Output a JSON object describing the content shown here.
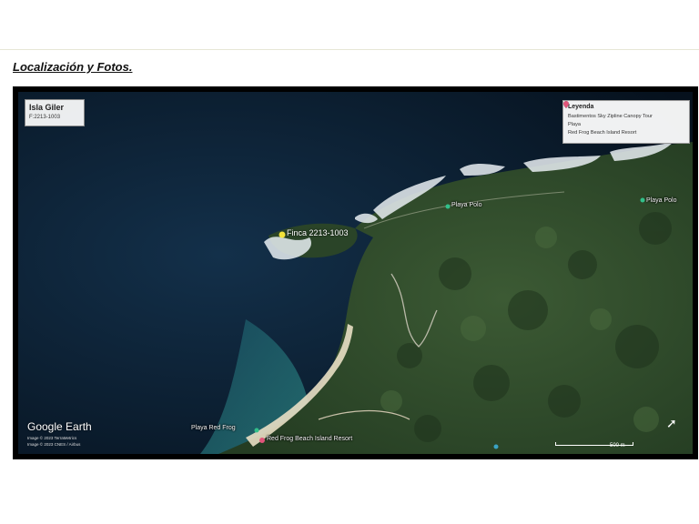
{
  "document": {
    "section_heading": "Localización y Fotos."
  },
  "map": {
    "title": "Isla Giler",
    "parcel_id": "F:2213-1003",
    "finca_label": "Finca 2213-1003",
    "legend": {
      "title": "Leyenda",
      "items": [
        {
          "label": "Bastimentos Sky Zipline Canopy Tour",
          "color": "#3aa3c4"
        },
        {
          "label": "Playa",
          "color": "#32c08a"
        },
        {
          "label": "Red Frog Beach Island Resort",
          "color": "#e0557a"
        }
      ]
    },
    "place_labels": {
      "playa_polo_1": "Playa Polo",
      "playa_polo_2": "Playa Polo",
      "playa_red_frog": "Playa Red Frog",
      "resort": "Red Frog Beach Island Resort"
    },
    "provider_logo": "Google Earth",
    "attribution": [
      "Image © 2023 TerraMetrics",
      "Image © 2023 CNES / Airbus"
    ],
    "scale_label": "500 m",
    "colors": {
      "ocean_deep": "#0a1a2c",
      "ocean_shallow": "#1d6a7a",
      "forest": "#2e4a2a",
      "pin_playa": "#32c08a",
      "pin_resort": "#e0557a",
      "finca_marker": "#f2e23a"
    }
  }
}
